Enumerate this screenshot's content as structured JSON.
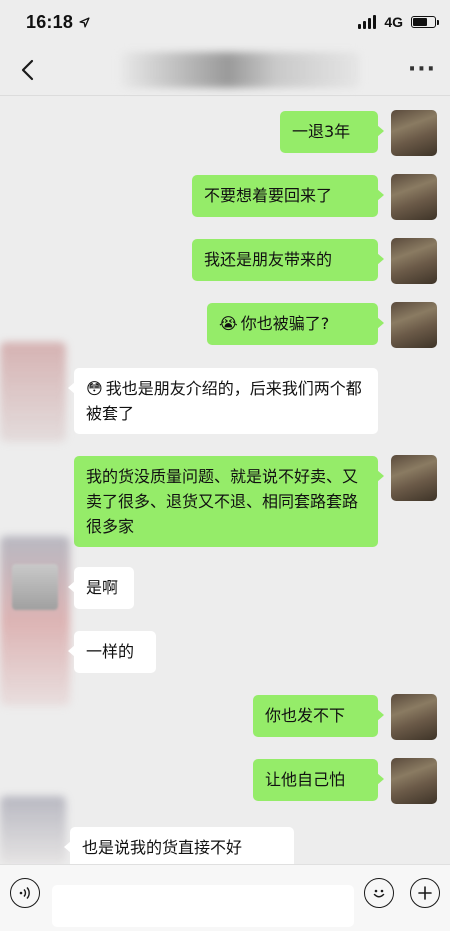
{
  "status_bar": {
    "time": "16:18",
    "network": "4G",
    "location_icon": "location-arrow-icon",
    "battery_level": 0.75
  },
  "header": {
    "back_icon": "chevron-left-icon",
    "title": "",
    "more_icon": "more-dots-icon"
  },
  "messages": [
    {
      "sender": "me",
      "text": "一退3年"
    },
    {
      "sender": "me",
      "text": "不要想着要回来了"
    },
    {
      "sender": "me",
      "text": "我还是朋友带来的"
    },
    {
      "sender": "me",
      "text": "你也被骗了?",
      "emoji": "😭"
    },
    {
      "sender": "other",
      "text": "我也是朋友介绍的，后来我们两个都被套了",
      "emoji": "😳"
    },
    {
      "sender": "me",
      "text": "我的货没质量问题、就是说不好卖、又卖了很多、退货又不退、相同套路套路很多家"
    },
    {
      "sender": "other",
      "text": "是啊"
    },
    {
      "sender": "other",
      "text": "一样的"
    },
    {
      "sender": "me",
      "text": "你也发不下"
    },
    {
      "sender": "me",
      "text": "让他自己怕"
    },
    {
      "sender": "other",
      "text": "也是说我的货直接不好"
    }
  ],
  "input_bar": {
    "voice_icon": "voice-icon",
    "emoji_icon": "smiley-icon",
    "plus_icon": "plus-icon",
    "placeholder": ""
  },
  "colors": {
    "background": "#ededed",
    "my_bubble": "#95ec69",
    "their_bubble": "#ffffff"
  }
}
